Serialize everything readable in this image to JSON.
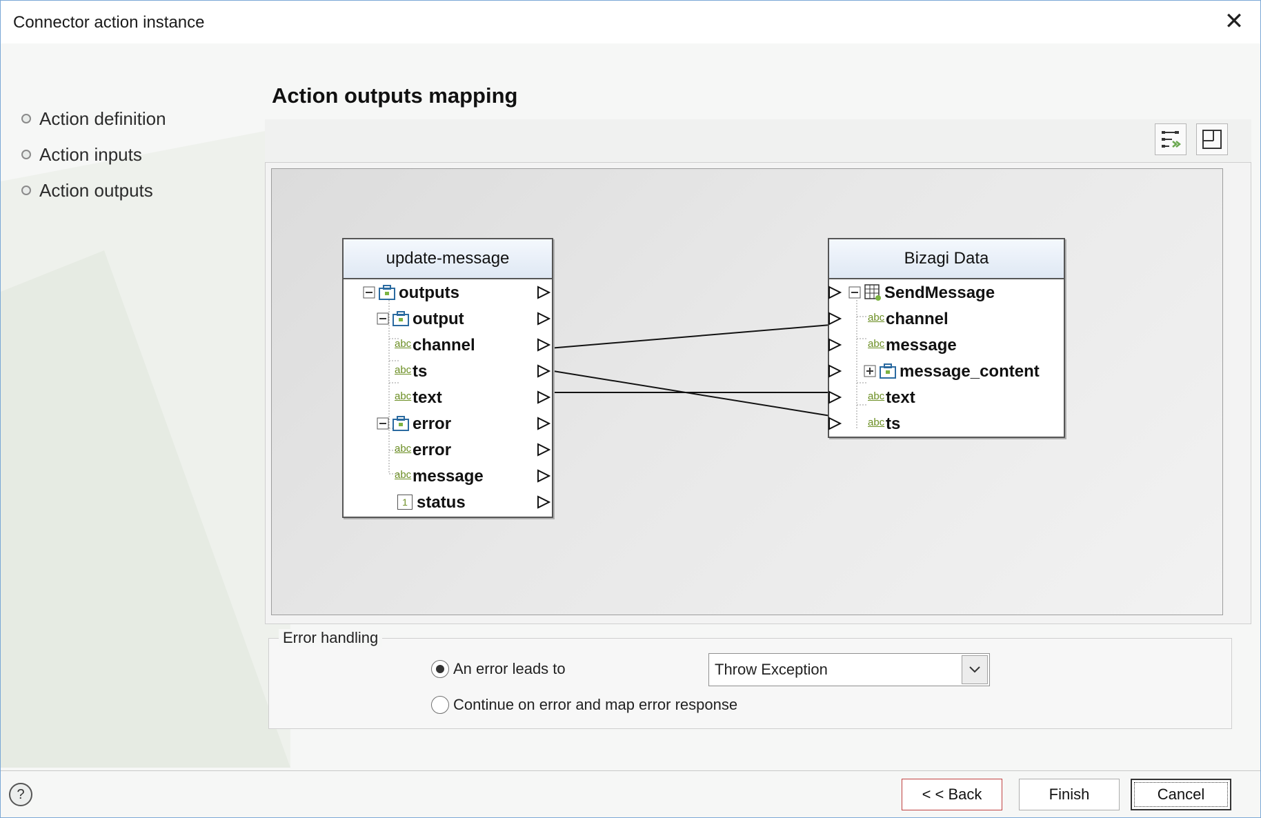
{
  "window": {
    "title": "Connector action instance"
  },
  "steps": [
    {
      "label": "Action definition"
    },
    {
      "label": "Action inputs"
    },
    {
      "label": "Action outputs"
    }
  ],
  "main": {
    "title": "Action outputs mapping"
  },
  "source_tree": {
    "title": "update-message",
    "nodes": [
      {
        "label": "outputs",
        "type": "object",
        "expanded": true
      },
      {
        "label": "output",
        "type": "object",
        "expanded": true
      },
      {
        "label": "channel",
        "type": "string"
      },
      {
        "label": "ts",
        "type": "string"
      },
      {
        "label": "text",
        "type": "string"
      },
      {
        "label": "error",
        "type": "object",
        "expanded": true
      },
      {
        "label": "error",
        "type": "string"
      },
      {
        "label": "message",
        "type": "string"
      },
      {
        "label": "status",
        "type": "number"
      }
    ]
  },
  "target_tree": {
    "title": "Bizagi Data",
    "nodes": [
      {
        "label": "SendMessage",
        "type": "entity",
        "expanded": true
      },
      {
        "label": "channel",
        "type": "string"
      },
      {
        "label": "message",
        "type": "string"
      },
      {
        "label": "message_content",
        "type": "object",
        "expanded": false
      },
      {
        "label": "text",
        "type": "string"
      },
      {
        "label": "ts",
        "type": "string"
      }
    ]
  },
  "mappings": [
    {
      "from": "channel",
      "to": "channel"
    },
    {
      "from": "ts",
      "to": "ts"
    },
    {
      "from": "text",
      "to": "text"
    }
  ],
  "type_badges": {
    "string": "abc",
    "number": "1"
  },
  "error_handling": {
    "legend": "Error handling",
    "option_error": "An error leads to",
    "option_continue": "Continue on error and map error response",
    "selected_option": "option_error",
    "action": "Throw Exception"
  },
  "footer": {
    "help": "?",
    "back": "< < Back",
    "finish": "Finish",
    "cancel": "Cancel"
  },
  "colors": {
    "border": "#7aa7d6",
    "header_gradient_top": "#f4f8fd",
    "header_gradient_bottom": "#dfe8f4",
    "abc_badge": "#6b8e23",
    "object_icon": "#2a6aa0",
    "entity_icon_accent": "#7cb342"
  }
}
